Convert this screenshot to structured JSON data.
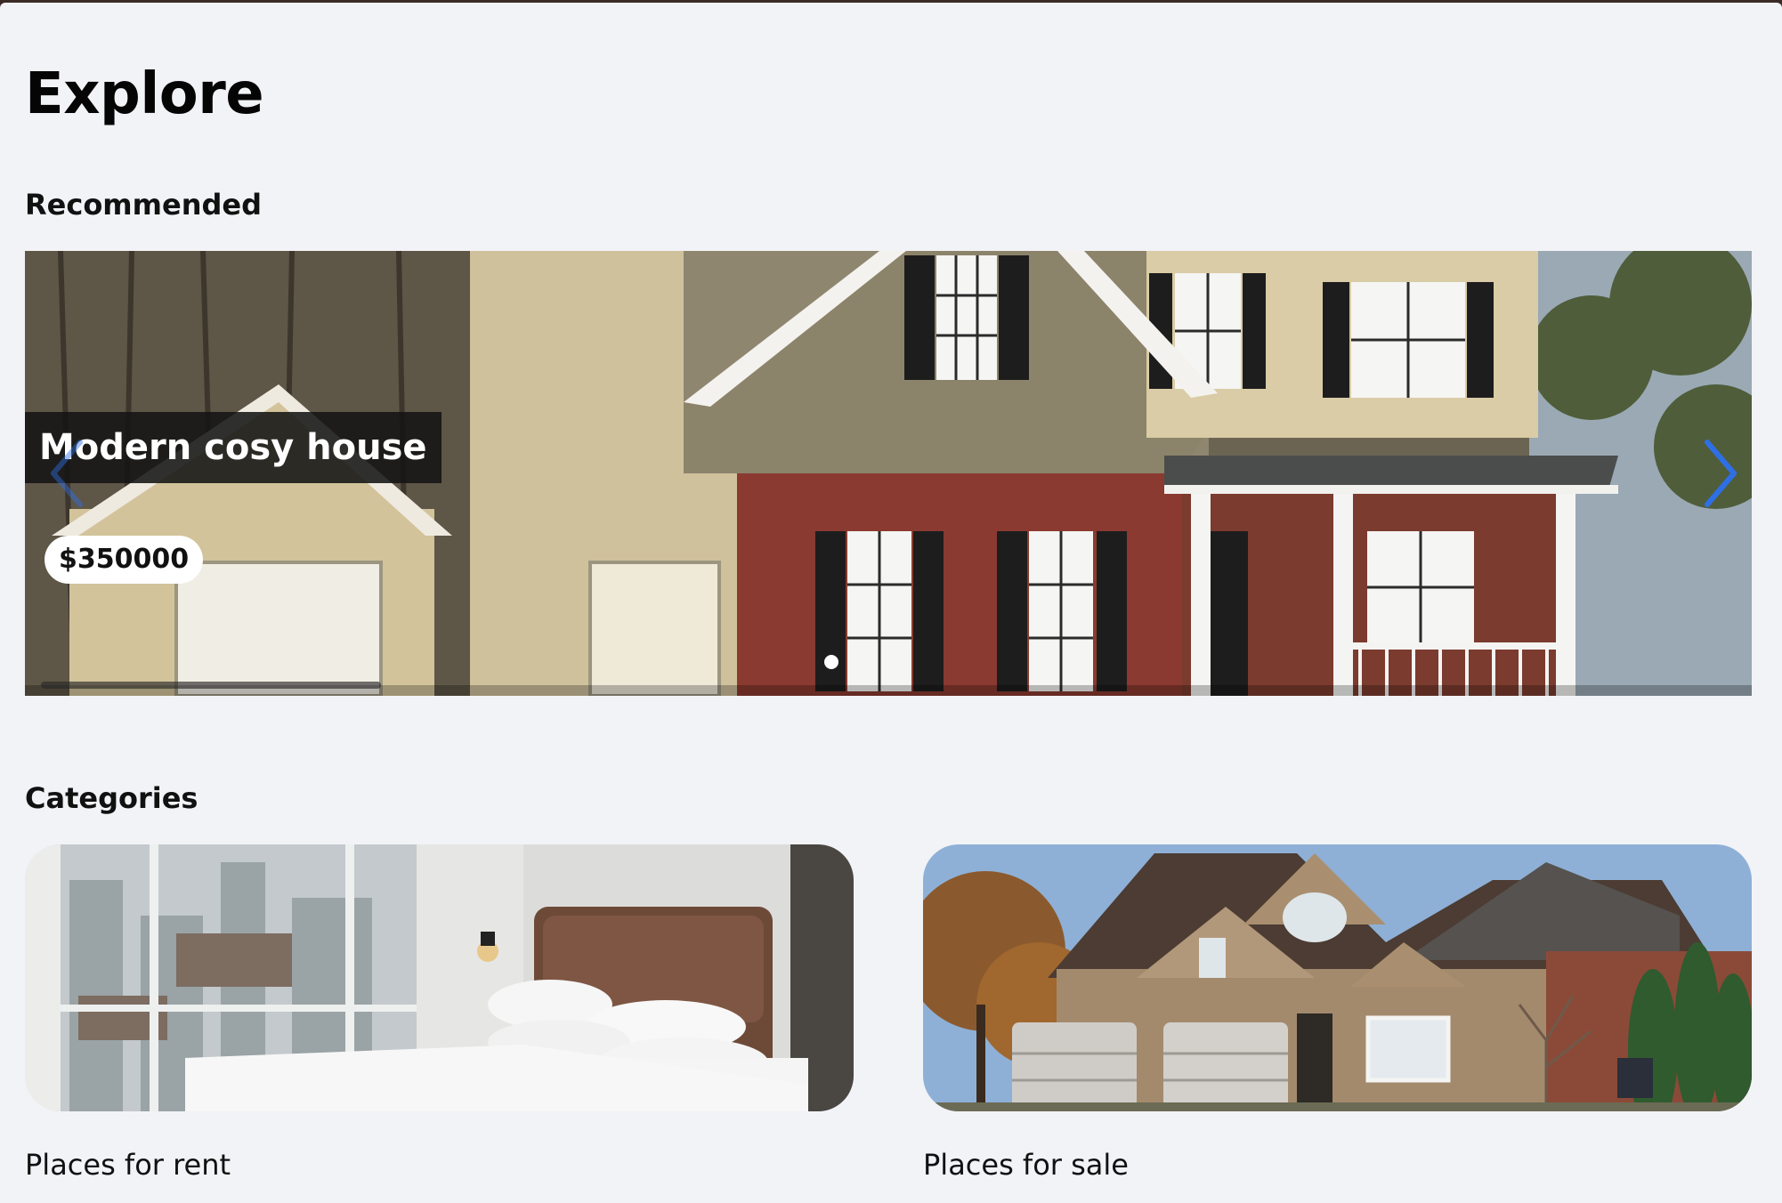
{
  "page": {
    "title": "Explore"
  },
  "recommended": {
    "heading": "Recommended",
    "slide": {
      "title": "Modern cosy house",
      "price": "$350000"
    },
    "prev_icon": "chevron-left-icon",
    "next_icon": "chevron-right-icon",
    "accent_color": "#2f6fe6"
  },
  "categories": {
    "heading": "Categories",
    "items": [
      {
        "label": "Places for rent",
        "image": "bedroom-photo"
      },
      {
        "label": "Places for sale",
        "image": "brick-house-photo"
      }
    ]
  }
}
